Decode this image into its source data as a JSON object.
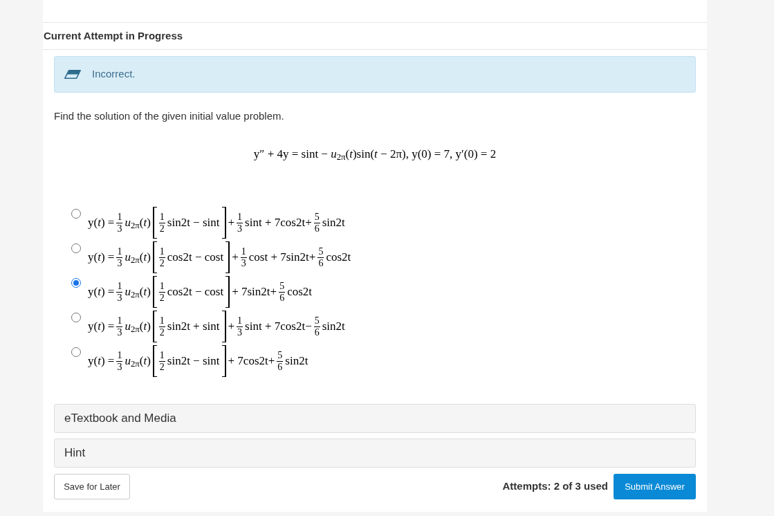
{
  "section": {
    "title": "Current Attempt in Progress"
  },
  "feedback": {
    "text": "Incorrect."
  },
  "question": {
    "prompt": "Find the solution of the given initial value problem.",
    "equation": "y″ + 4y = sint − *u*$_{2π}$(*t*)sin(*t* − 2π), y(0) = 7, y′(0) = 2"
  },
  "options": [
    {
      "selected": false,
      "parts": [
        {
          "kind": "text",
          "text": "y(*t*) ="
        },
        {
          "kind": "frac",
          "num": "1",
          "den": "3"
        },
        {
          "kind": "text",
          "text": "*u*$_{2π}$(*t*)"
        },
        {
          "kind": "bracket",
          "parts": [
            {
              "kind": "frac",
              "num": "1",
              "den": "2"
            },
            {
              "kind": "text",
              "text": "sin2t − sint"
            }
          ]
        },
        {
          "kind": "text",
          "text": "+"
        },
        {
          "kind": "frac",
          "num": "1",
          "den": "3"
        },
        {
          "kind": "text",
          "text": "sint + 7cos2t+"
        },
        {
          "kind": "frac",
          "num": "5",
          "den": "6"
        },
        {
          "kind": "text",
          "text": "sin2t"
        }
      ]
    },
    {
      "selected": false,
      "parts": [
        {
          "kind": "text",
          "text": "y(*t*) ="
        },
        {
          "kind": "frac",
          "num": "1",
          "den": "3"
        },
        {
          "kind": "text",
          "text": "*u*$_{2π}$(*t*)"
        },
        {
          "kind": "bracket",
          "parts": [
            {
              "kind": "frac",
              "num": "1",
              "den": "2"
            },
            {
              "kind": "text",
              "text": "cos2t − cost"
            }
          ]
        },
        {
          "kind": "text",
          "text": "+"
        },
        {
          "kind": "frac",
          "num": "1",
          "den": "3"
        },
        {
          "kind": "text",
          "text": "cost + 7sin2t+"
        },
        {
          "kind": "frac",
          "num": "5",
          "den": "6"
        },
        {
          "kind": "text",
          "text": "cos2t"
        }
      ]
    },
    {
      "selected": true,
      "parts": [
        {
          "kind": "text",
          "text": "y(*t*) ="
        },
        {
          "kind": "frac",
          "num": "1",
          "den": "3"
        },
        {
          "kind": "text",
          "text": "*u*$_{2π}$(*t*)"
        },
        {
          "kind": "bracket",
          "parts": [
            {
              "kind": "frac",
              "num": "1",
              "den": "2"
            },
            {
              "kind": "text",
              "text": "cos2t − cost"
            }
          ]
        },
        {
          "kind": "text",
          "text": "+ 7sin2t+"
        },
        {
          "kind": "frac",
          "num": "5",
          "den": "6"
        },
        {
          "kind": "text",
          "text": "cos2t"
        }
      ]
    },
    {
      "selected": false,
      "parts": [
        {
          "kind": "text",
          "text": "y(*t*) ="
        },
        {
          "kind": "frac",
          "num": "1",
          "den": "3"
        },
        {
          "kind": "text",
          "text": "*u*$_{2π}$(*t*)"
        },
        {
          "kind": "bracket",
          "parts": [
            {
              "kind": "frac",
              "num": "1",
              "den": "2"
            },
            {
              "kind": "text",
              "text": "sin2t + sint"
            }
          ]
        },
        {
          "kind": "text",
          "text": "+"
        },
        {
          "kind": "frac",
          "num": "1",
          "den": "3"
        },
        {
          "kind": "text",
          "text": "sint + 7cos2t−"
        },
        {
          "kind": "frac",
          "num": "5",
          "den": "6"
        },
        {
          "kind": "text",
          "text": "sin2t"
        }
      ]
    },
    {
      "selected": false,
      "parts": [
        {
          "kind": "text",
          "text": "y(*t*) ="
        },
        {
          "kind": "frac",
          "num": "1",
          "den": "3"
        },
        {
          "kind": "text",
          "text": "*u*$_{2π}$(*t*)"
        },
        {
          "kind": "bracket",
          "parts": [
            {
              "kind": "frac",
              "num": "1",
              "den": "2"
            },
            {
              "kind": "text",
              "text": "sin2t − sint"
            }
          ]
        },
        {
          "kind": "text",
          "text": "+ 7cos2t+"
        },
        {
          "kind": "frac",
          "num": "5",
          "den": "6"
        },
        {
          "kind": "text",
          "text": "sin2t"
        }
      ]
    }
  ],
  "panels": [
    {
      "label": "eTextbook and Media"
    },
    {
      "label": "Hint"
    }
  ],
  "footer": {
    "save_button": "Save for Later",
    "attempts": "Attempts: 2 of 3 used",
    "submit_button": "Submit Answer"
  }
}
